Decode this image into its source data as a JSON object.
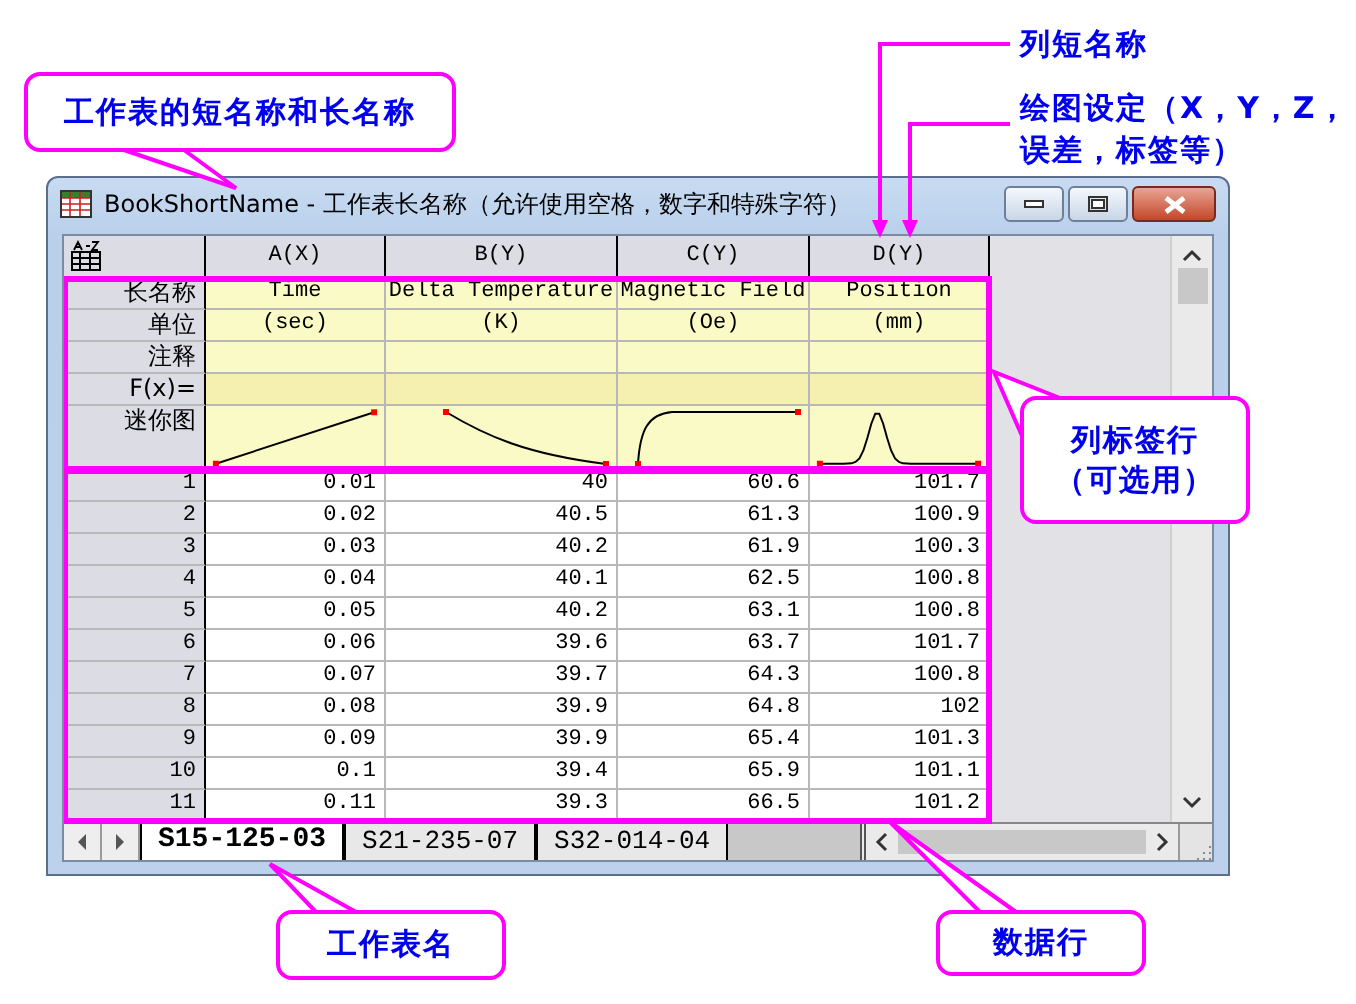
{
  "window": {
    "title": "BookShortName - 工作表长名称（允许使用空格，数字和特殊字符）"
  },
  "columns": [
    {
      "short_name": "A(X)",
      "long_name": "Time",
      "units": "(sec)",
      "kind": "linear"
    },
    {
      "short_name": "B(Y)",
      "long_name": "Delta Temperature",
      "units": "(K)",
      "kind": "decay"
    },
    {
      "short_name": "C(Y)",
      "long_name": "Magnetic Field",
      "units": "(Oe)",
      "kind": "saturation"
    },
    {
      "short_name": "D(Y)",
      "long_name": "Position",
      "units": "(mm)",
      "kind": "peak"
    }
  ],
  "label_rows": [
    "长名称",
    "单位",
    "注释",
    "F(x)=",
    "迷你图"
  ],
  "rows": [
    {
      "index": "1",
      "cells": [
        "0.01",
        "40",
        "60.6",
        "101.7"
      ]
    },
    {
      "index": "2",
      "cells": [
        "0.02",
        "40.5",
        "61.3",
        "100.9"
      ]
    },
    {
      "index": "3",
      "cells": [
        "0.03",
        "40.2",
        "61.9",
        "100.3"
      ]
    },
    {
      "index": "4",
      "cells": [
        "0.04",
        "40.1",
        "62.5",
        "100.8"
      ]
    },
    {
      "index": "5",
      "cells": [
        "0.05",
        "40.2",
        "63.1",
        "100.8"
      ]
    },
    {
      "index": "6",
      "cells": [
        "0.06",
        "39.6",
        "63.7",
        "101.7"
      ]
    },
    {
      "index": "7",
      "cells": [
        "0.07",
        "39.7",
        "64.3",
        "100.8"
      ]
    },
    {
      "index": "8",
      "cells": [
        "0.08",
        "39.9",
        "64.8",
        "102"
      ]
    },
    {
      "index": "9",
      "cells": [
        "0.09",
        "39.9",
        "65.4",
        "101.3"
      ]
    },
    {
      "index": "10",
      "cells": [
        "0.1",
        "39.4",
        "65.9",
        "101.1"
      ]
    },
    {
      "index": "11",
      "cells": [
        "0.11",
        "39.3",
        "66.5",
        "101.2"
      ]
    }
  ],
  "sheet_tabs": [
    {
      "label": "S15-125-03",
      "selected": true
    },
    {
      "label": "S21-235-07",
      "selected": false
    },
    {
      "label": "S32-014-04",
      "selected": false
    }
  ],
  "annotations": [
    {
      "kind": "callout",
      "lines": [
        "工作表的短名称和长名称"
      ]
    },
    {
      "kind": "arrow",
      "lines": [
        "列短名称"
      ]
    },
    {
      "kind": "arrow",
      "lines": [
        "绘图设定（X，Y，Z，",
        "误差，标签等）"
      ]
    },
    {
      "kind": "callout",
      "lines": [
        "列标签行",
        "（可选用）"
      ]
    },
    {
      "kind": "callout",
      "lines": [
        "工作表名"
      ]
    },
    {
      "kind": "callout",
      "lines": [
        "数据行"
      ]
    }
  ]
}
